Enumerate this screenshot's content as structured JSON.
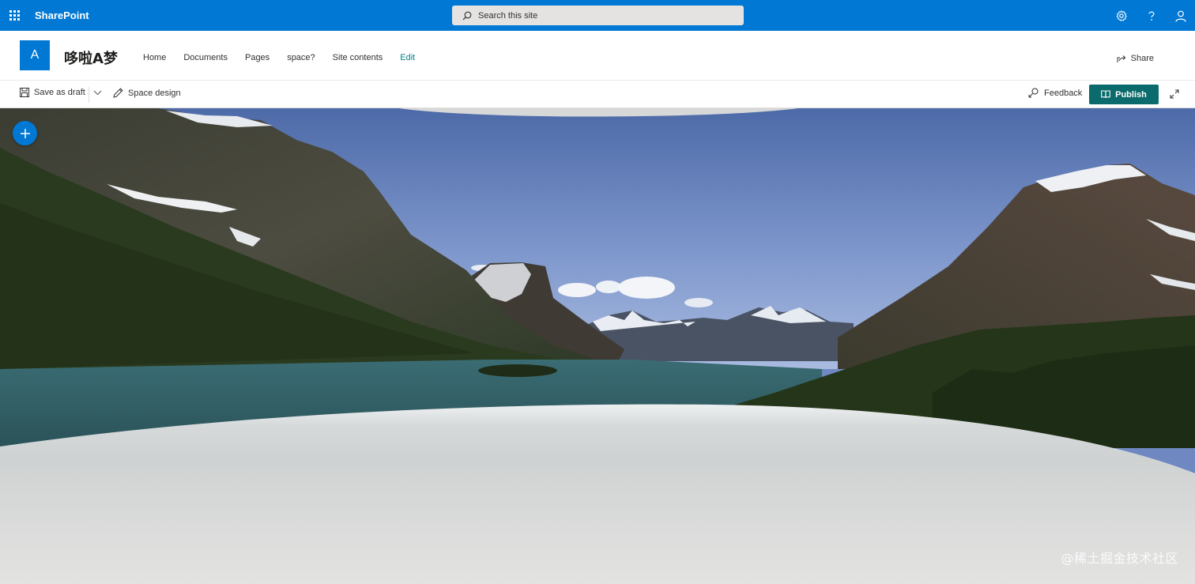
{
  "suite": {
    "brand": "SharePoint",
    "search_placeholder": "Search this site"
  },
  "site": {
    "logo_letter": "A",
    "title": "哆啦A梦",
    "nav": [
      "Home",
      "Documents",
      "Pages",
      "space?",
      "Site contents",
      "Edit"
    ],
    "share_label": "Share"
  },
  "commands": {
    "save_draft": "Save as draft",
    "space_design": "Space design",
    "feedback": "Feedback",
    "publish": "Publish"
  },
  "watermark": "@稀土掘金技术社区",
  "icons": {
    "waffle": "app-launcher-icon",
    "search": "search-icon",
    "settings": "gear-icon",
    "help": "help-icon",
    "account": "person-icon",
    "share": "share-icon",
    "save": "floppy-disk-icon",
    "dropdown": "chevron-down-icon",
    "pencil": "pencil-icon",
    "feedback": "feedback-icon",
    "publish": "book-icon",
    "expand": "expand-icon",
    "add": "plus-icon"
  },
  "colors": {
    "suite_bar": "#0078d4",
    "publish_button": "#0b6a6b",
    "edit_link": "#038387"
  }
}
